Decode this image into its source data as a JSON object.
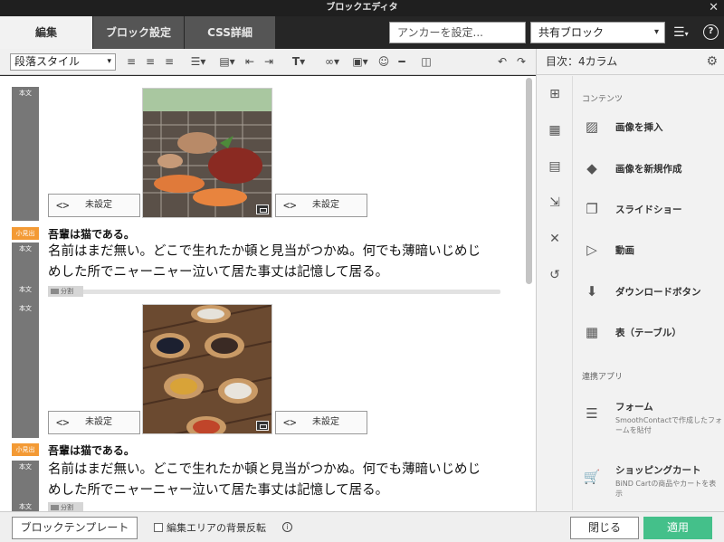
{
  "window": {
    "title": "ブロックエディタ",
    "close_icon": "close-icon"
  },
  "tabs": [
    {
      "label": "編集",
      "active": true
    },
    {
      "label": "ブロック設定",
      "active": false
    },
    {
      "label": "CSS詳細",
      "active": false
    }
  ],
  "anchor": {
    "placeholder": "アンカーを設定..."
  },
  "shared_block": {
    "value": "共有ブロック"
  },
  "toolbar": {
    "paragraph_style": "段落スタイル",
    "icons": [
      "align-left-icon",
      "align-center-icon",
      "align-right-icon",
      "bullet-list-icon",
      "block-icon",
      "indent-left-icon",
      "indent-right-icon",
      "text-format-icon",
      "link-icon",
      "image-icon",
      "emoji-icon",
      "horizontal-rule-icon",
      "column-icon",
      "undo-icon",
      "redo-icon"
    ]
  },
  "editor": {
    "tag_body": "本文",
    "tag_small_heading": "小見出",
    "unset_label": "未設定",
    "divider_label": "分割",
    "heading": "吾輩は猫である。",
    "paragraph_line1": "名前はまだ無い。どこで生れたか頓と見当がつかぬ。何でも薄暗いじめじ",
    "paragraph_line2": "めじめした所でニャーニャー泣いて居た事丈は記憶して居る。",
    "paragraph_line2_fixed": "めした所でニャーニャー泣いて居た事丈は記憶して居る。"
  },
  "panel": {
    "header": "目次：4カラム",
    "section_contents": "コンテンツ",
    "section_apps": "連携アプリ",
    "items": [
      {
        "label": "画像を挿入",
        "icon": "image-icon"
      },
      {
        "label": "画像を新規作成",
        "icon": "shapes-icon"
      },
      {
        "label": "スライドショー",
        "icon": "slideshow-icon"
      },
      {
        "label": "動画",
        "icon": "video-icon"
      },
      {
        "label": "ダウンロードボタン",
        "icon": "download-icon"
      },
      {
        "label": "表（テーブル）",
        "icon": "table-icon"
      }
    ],
    "apps": [
      {
        "label": "フォーム",
        "sub": "SmoothContactで作成したフォームを貼付",
        "icon": "form-icon"
      },
      {
        "label": "ショッピングカート",
        "sub": "BiND Cartの商品やカートを表示",
        "icon": "cart-icon"
      }
    ]
  },
  "footer": {
    "template_button": "ブロックテンプレート",
    "invert_label": "編集エリアの背景反転",
    "close_button": "閉じる",
    "apply_button": "適用"
  },
  "colors": {
    "apply": "#44c08a",
    "tag_orange": "#f39a35",
    "tag_gray": "#777777"
  }
}
